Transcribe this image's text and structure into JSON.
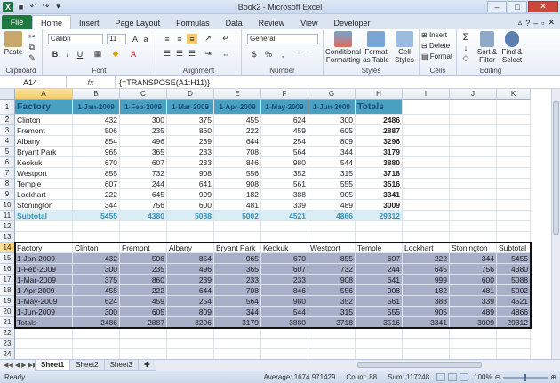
{
  "window": {
    "title": "Book2 - Microsoft Excel",
    "app_icon": "X"
  },
  "tabs": [
    "File",
    "Home",
    "Insert",
    "Page Layout",
    "Formulas",
    "Data",
    "Review",
    "View",
    "Developer"
  ],
  "active_tab": "Home",
  "ribbon": {
    "clipboard": {
      "paste": "Paste",
      "label": "Clipboard"
    },
    "font": {
      "name": "Calibri",
      "size": "11",
      "label": "Font",
      "bold": "B",
      "italic": "I",
      "underline": "U"
    },
    "alignment": {
      "label": "Alignment"
    },
    "number": {
      "format": "General",
      "label": "Number",
      "currency": "$",
      "percent": "%",
      "comma": ","
    },
    "styles": {
      "conditional": "Conditional Formatting",
      "format_table": "Format as Table",
      "cell_styles": "Cell Styles",
      "label": "Styles"
    },
    "cells": {
      "insert": "Insert",
      "delete": "Delete",
      "format": "Format",
      "label": "Cells"
    },
    "editing": {
      "sum": "Σ",
      "sort": "Sort & Filter",
      "find": "Find & Select",
      "label": "Editing"
    }
  },
  "formula_bar": {
    "name_box": "A14",
    "fx": "fx",
    "formula": "{=TRANSPOSE(A1:H11)}"
  },
  "columns": [
    "A",
    "B",
    "C",
    "D",
    "E",
    "F",
    "G",
    "H",
    "I",
    "J",
    "K"
  ],
  "rows": [
    "1",
    "2",
    "3",
    "4",
    "5",
    "6",
    "7",
    "8",
    "9",
    "10",
    "11",
    "12",
    "13",
    "14",
    "15",
    "16",
    "17",
    "18",
    "19",
    "20",
    "21",
    "22",
    "23",
    "24"
  ],
  "table1": {
    "header": [
      "Factory",
      "1-Jan-2009",
      "1-Feb-2009",
      "1-Mar-2009",
      "1-Apr-2009",
      "1-May-2009",
      "1-Jun-2009",
      "Totals"
    ],
    "rows": [
      [
        "Clinton",
        "432",
        "300",
        "375",
        "455",
        "624",
        "300",
        "2486"
      ],
      [
        "Fremont",
        "506",
        "235",
        "860",
        "222",
        "459",
        "605",
        "2887"
      ],
      [
        "Albany",
        "854",
        "496",
        "239",
        "644",
        "254",
        "809",
        "3296"
      ],
      [
        "Bryant Park",
        "965",
        "365",
        "233",
        "708",
        "564",
        "344",
        "3179"
      ],
      [
        "Keokuk",
        "670",
        "607",
        "233",
        "846",
        "980",
        "544",
        "3880"
      ],
      [
        "Westport",
        "855",
        "732",
        "908",
        "556",
        "352",
        "315",
        "3718"
      ],
      [
        "Temple",
        "607",
        "244",
        "641",
        "908",
        "561",
        "555",
        "3516"
      ],
      [
        "Lockhart",
        "222",
        "645",
        "999",
        "182",
        "388",
        "905",
        "3341"
      ],
      [
        "Stonington",
        "344",
        "756",
        "600",
        "481",
        "339",
        "489",
        "3009"
      ]
    ],
    "subtotal": [
      "Subtotal",
      "5455",
      "4380",
      "5088",
      "5002",
      "4521",
      "4866",
      "29312"
    ]
  },
  "table2": {
    "header": [
      "Factory",
      "Clinton",
      "Fremont",
      "Albany",
      "Bryant Park",
      "Keokuk",
      "Westport",
      "Temple",
      "Lockhart",
      "Stonington",
      "Subtotal"
    ],
    "rows": [
      [
        "1-Jan-2009",
        "432",
        "506",
        "854",
        "965",
        "670",
        "855",
        "607",
        "222",
        "344",
        "5455"
      ],
      [
        "1-Feb-2009",
        "300",
        "235",
        "496",
        "365",
        "607",
        "732",
        "244",
        "645",
        "756",
        "4380"
      ],
      [
        "1-Mar-2009",
        "375",
        "860",
        "239",
        "233",
        "233",
        "908",
        "641",
        "999",
        "600",
        "5088"
      ],
      [
        "1-Apr-2009",
        "455",
        "222",
        "644",
        "708",
        "846",
        "556",
        "908",
        "182",
        "481",
        "5002"
      ],
      [
        "1-May-2009",
        "624",
        "459",
        "254",
        "564",
        "980",
        "352",
        "561",
        "388",
        "339",
        "4521"
      ],
      [
        "1-Jun-2009",
        "300",
        "605",
        "809",
        "344",
        "544",
        "315",
        "555",
        "905",
        "489",
        "4866"
      ],
      [
        "Totals",
        "2486",
        "2887",
        "3296",
        "3179",
        "3880",
        "3718",
        "3516",
        "3341",
        "3009",
        "29312"
      ]
    ]
  },
  "sheets": [
    "Sheet1",
    "Sheet2",
    "Sheet3"
  ],
  "active_sheet": "Sheet1",
  "status": {
    "ready": "Ready",
    "average": "Average: 1674.971429",
    "count": "Count: 88",
    "sum": "Sum: 117248",
    "zoom": "100%"
  },
  "colors": {
    "header_fill": "#4aa0c0",
    "subtotal_fill": "#d9edf4",
    "transpose_fill": "#a7afc9",
    "file_tab": "#1f7a3f"
  }
}
